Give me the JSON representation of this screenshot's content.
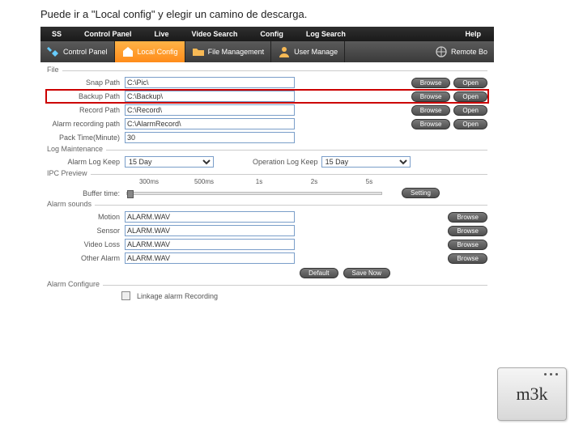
{
  "caption": "Puede ir a \"Local config\" y elegir un camino de descarga.",
  "menubar": {
    "ss": "SS",
    "items": [
      "Control Panel",
      "Live",
      "Video Search",
      "Config",
      "Log Search",
      "Help"
    ]
  },
  "toolbar": {
    "tabs": [
      {
        "label": "Control Panel"
      },
      {
        "label": "Local Config"
      },
      {
        "label": "File Management"
      },
      {
        "label": "User Manage"
      },
      {
        "label": "Remote Bo"
      }
    ]
  },
  "file": {
    "legend": "File",
    "snap_label": "Snap Path",
    "snap_value": "C:\\Pic\\",
    "backup_label": "Backup Path",
    "backup_value": "C:\\Backup\\",
    "record_label": "Record Path",
    "record_value": "C:\\Record\\",
    "alarm_rec_label": "Alarm recording path",
    "alarm_rec_value": "C:\\AlarmRecord\\",
    "pack_label": "Pack Time(Minute)",
    "pack_value": "30",
    "browse": "Browse",
    "open": "Open"
  },
  "log": {
    "legend": "Log Maintenance",
    "alarm_keep_label": "Alarm Log Keep",
    "alarm_keep_value": "15 Day",
    "op_keep_label": "Operation Log Keep",
    "op_keep_value": "15 Day"
  },
  "ipc": {
    "legend": "IPC Preview",
    "marks": [
      "300ms",
      "500ms",
      "1s",
      "2s",
      "5s"
    ],
    "buffer_label": "Buffer time:",
    "setting": "Setting"
  },
  "sounds": {
    "legend": "Alarm sounds",
    "motion_label": "Motion",
    "motion_value": "ALARM.WAV",
    "sensor_label": "Sensor",
    "sensor_value": "ALARM.WAV",
    "vloss_label": "Video Loss",
    "vloss_value": "ALARM.WAV",
    "other_label": "Other Alarm",
    "other_value": "ALARM.WAV",
    "browse": "Browse",
    "default": "Default",
    "save": "Save Now"
  },
  "alarm_cfg": {
    "legend": "Alarm Configure",
    "linkage": "Linkage alarm Recording"
  },
  "logo": "m3k"
}
